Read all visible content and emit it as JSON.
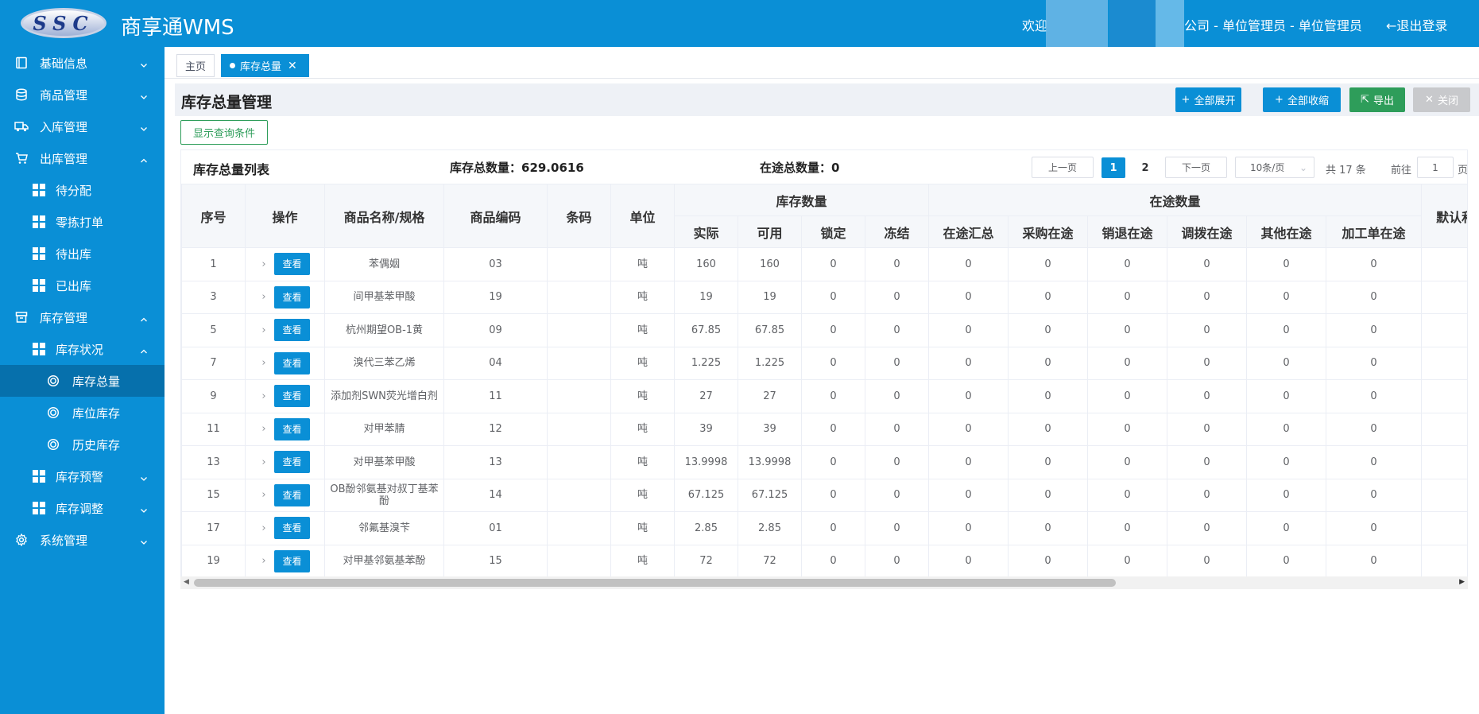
{
  "header": {
    "logo_text": "SSC",
    "app_title": "商享通WMS",
    "welcome": "欢迎",
    "user_info": "公司 - 单位管理员 - 单位管理员",
    "logout": "←退出登录"
  },
  "sidebar": {
    "items": [
      {
        "label": "基础信息",
        "icon": "book-icon",
        "chevron": "down"
      },
      {
        "label": "商品管理",
        "icon": "database-icon",
        "chevron": "down"
      },
      {
        "label": "入库管理",
        "icon": "truck-icon",
        "chevron": "down"
      },
      {
        "label": "出库管理",
        "icon": "cart-icon",
        "chevron": "up"
      },
      {
        "label": "待分配",
        "icon": "grid-icon"
      },
      {
        "label": "零拣打单",
        "icon": "grid-icon"
      },
      {
        "label": "待出库",
        "icon": "grid-icon"
      },
      {
        "label": "已出库",
        "icon": "grid-icon"
      },
      {
        "label": "库存管理",
        "icon": "box-icon",
        "chevron": "up"
      },
      {
        "label": "库存状况",
        "icon": "grid-icon",
        "chevron": "up"
      },
      {
        "label": "库存总量",
        "icon": "circle-icon",
        "active": true
      },
      {
        "label": "库位库存",
        "icon": "circle-icon"
      },
      {
        "label": "历史库存",
        "icon": "circle-icon"
      },
      {
        "label": "库存预警",
        "icon": "grid-icon",
        "chevron": "down"
      },
      {
        "label": "库存调整",
        "icon": "grid-icon",
        "chevron": "down"
      },
      {
        "label": "系统管理",
        "icon": "gear-icon",
        "chevron": "down"
      }
    ]
  },
  "tabs": [
    {
      "label": "主页"
    },
    {
      "label": "库存总量",
      "close": "✕"
    }
  ],
  "page": {
    "title": "库存总量管理",
    "buttons": {
      "expand_all": "全部展开",
      "collapse_all": "全部收缩",
      "export": "导出",
      "close": "关闭"
    },
    "query_toggle": "显示查询条件"
  },
  "colors": {
    "primary": "#0a8fd6",
    "success": "#2e9d5a",
    "disabled": "#c8c9cc"
  },
  "panel": {
    "title": "库存总量列表",
    "total_label": "库存总数量：629.0616",
    "transit_label": "在途总数量：0",
    "pagination": {
      "prev": "上一页",
      "pages": [
        "1",
        "2"
      ],
      "next": "下一页",
      "page_size": "10条/页",
      "total": "共 17 条",
      "goto": "前往",
      "goto_value": "1",
      "page_unit": "页"
    }
  },
  "table": {
    "headers": {
      "seq": "序号",
      "ops": "操作",
      "name": "商品名称/规格",
      "code": "商品编码",
      "barcode": "条码",
      "unit": "单位",
      "stock_group": "库存数量",
      "actual": "实际",
      "available": "可用",
      "locked": "锁定",
      "frozen": "冻结",
      "transit_group": "在途数量",
      "transit_sum": "在途汇总",
      "purchase": "采购在途",
      "sales_return": "销退在途",
      "transfer": "调拨在途",
      "other": "其他在途",
      "processing": "加工单在途",
      "default": "默认和"
    },
    "view_label": "查看",
    "expand_glyph": "›",
    "rows": [
      [
        "1",
        "苯偶姻",
        "03",
        "",
        "吨",
        "160",
        "160",
        "0",
        "0",
        "0",
        "0",
        "0",
        "0",
        "0",
        "0"
      ],
      [
        "3",
        "间甲基苯甲酸",
        "19",
        "",
        "吨",
        "19",
        "19",
        "0",
        "0",
        "0",
        "0",
        "0",
        "0",
        "0",
        "0"
      ],
      [
        "5",
        "杭州期望OB-1黄",
        "09",
        "",
        "吨",
        "67.85",
        "67.85",
        "0",
        "0",
        "0",
        "0",
        "0",
        "0",
        "0",
        "0"
      ],
      [
        "7",
        "溴代三苯乙烯",
        "04",
        "",
        "吨",
        "1.225",
        "1.225",
        "0",
        "0",
        "0",
        "0",
        "0",
        "0",
        "0",
        "0"
      ],
      [
        "9",
        "添加剂SWN荧光增白剂",
        "11",
        "",
        "吨",
        "27",
        "27",
        "0",
        "0",
        "0",
        "0",
        "0",
        "0",
        "0",
        "0"
      ],
      [
        "11",
        "对甲苯腈",
        "12",
        "",
        "吨",
        "39",
        "39",
        "0",
        "0",
        "0",
        "0",
        "0",
        "0",
        "0",
        "0"
      ],
      [
        "13",
        "对甲基苯甲酸",
        "13",
        "",
        "吨",
        "13.9998",
        "13.9998",
        "0",
        "0",
        "0",
        "0",
        "0",
        "0",
        "0",
        "0"
      ],
      [
        "15",
        "OB酚邻氨基对叔丁基苯酚",
        "14",
        "",
        "吨",
        "67.125",
        "67.125",
        "0",
        "0",
        "0",
        "0",
        "0",
        "0",
        "0",
        "0"
      ],
      [
        "17",
        "邻氟基溴苄",
        "01",
        "",
        "吨",
        "2.85",
        "2.85",
        "0",
        "0",
        "0",
        "0",
        "0",
        "0",
        "0",
        "0"
      ],
      [
        "19",
        "对甲基邻氨基苯酚",
        "15",
        "",
        "吨",
        "72",
        "72",
        "0",
        "0",
        "0",
        "0",
        "0",
        "0",
        "0",
        "0"
      ]
    ]
  }
}
